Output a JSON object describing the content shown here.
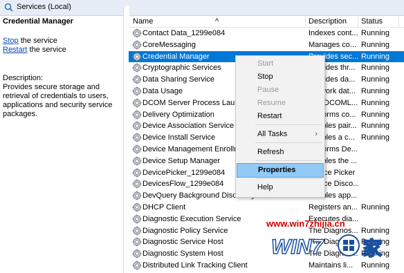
{
  "window": {
    "title": "Services (Local)"
  },
  "left_pane": {
    "service_name": "Credential Manager",
    "stop_link": "Stop",
    "stop_rest": " the service",
    "restart_link": "Restart",
    "restart_rest": " the service",
    "description_label": "Description:",
    "description_text": "Provides secure storage and retrieval of credentials to users, applications and security service packages."
  },
  "columns": {
    "name": "Name",
    "description": "Description",
    "status": "Status"
  },
  "services": [
    {
      "name": "Contact Data_1299e084",
      "description": "Indexes cont...",
      "status": "Running"
    },
    {
      "name": "CoreMessaging",
      "description": "Manages co...",
      "status": "Running"
    },
    {
      "name": "Credential Manager",
      "description": "Provides sec...",
      "status": "Running"
    },
    {
      "name": "Cryptographic Services",
      "description": "Provides thr...",
      "status": "Running"
    },
    {
      "name": "Data Sharing Service",
      "description": "Provides da...",
      "status": "Running"
    },
    {
      "name": "Data Usage",
      "description": "Network dat...",
      "status": "Running"
    },
    {
      "name": "DCOM Server Process Launcher",
      "description": "The DCOML...",
      "status": "Running"
    },
    {
      "name": "Delivery Optimization",
      "description": "Performs co...",
      "status": "Running"
    },
    {
      "name": "Device Association Service",
      "description": "Enables pair...",
      "status": "Running"
    },
    {
      "name": "Device Install Service",
      "description": "Enables a c...",
      "status": "Running"
    },
    {
      "name": "Device Management Enrollment Service",
      "description": "Performs De...",
      "status": ""
    },
    {
      "name": "Device Setup Manager",
      "description": "Enables the ...",
      "status": ""
    },
    {
      "name": "DevicePicker_1299e084",
      "description": "Device Picker",
      "status": ""
    },
    {
      "name": "DevicesFlow_1299e084",
      "description": "Device Disco...",
      "status": ""
    },
    {
      "name": "DevQuery Background Discovery Broker",
      "description": "Enables app...",
      "status": ""
    },
    {
      "name": "DHCP Client",
      "description": "Registers an...",
      "status": "Running"
    },
    {
      "name": "Diagnostic Execution Service",
      "description": "Executes dia...",
      "status": ""
    },
    {
      "name": "Diagnostic Policy Service",
      "description": "The Diagnos...",
      "status": "Running"
    },
    {
      "name": "Diagnostic Service Host",
      "description": "The Diagnos...",
      "status": "Running"
    },
    {
      "name": "Diagnostic System Host",
      "description": "The Diagnos...",
      "status": "Running"
    },
    {
      "name": "Distributed Link Tracking Client",
      "description": "Maintains li...",
      "status": "Running"
    }
  ],
  "context_menu": {
    "start": "Start",
    "stop": "Stop",
    "pause": "Pause",
    "resume": "Resume",
    "restart": "Restart",
    "all_tasks": "All Tasks",
    "submenu_arrow": "›",
    "refresh": "Refresh",
    "properties": "Properties",
    "help": "Help"
  },
  "watermark": {
    "url": "www.win7zhijia.cn",
    "logo_text": "WIN7之家"
  },
  "colors": {
    "selection": "#0078d7",
    "menu_highlight": "#91c9f7",
    "watermark_red": "#d40000",
    "watermark_blue": "#1a4fa0"
  }
}
